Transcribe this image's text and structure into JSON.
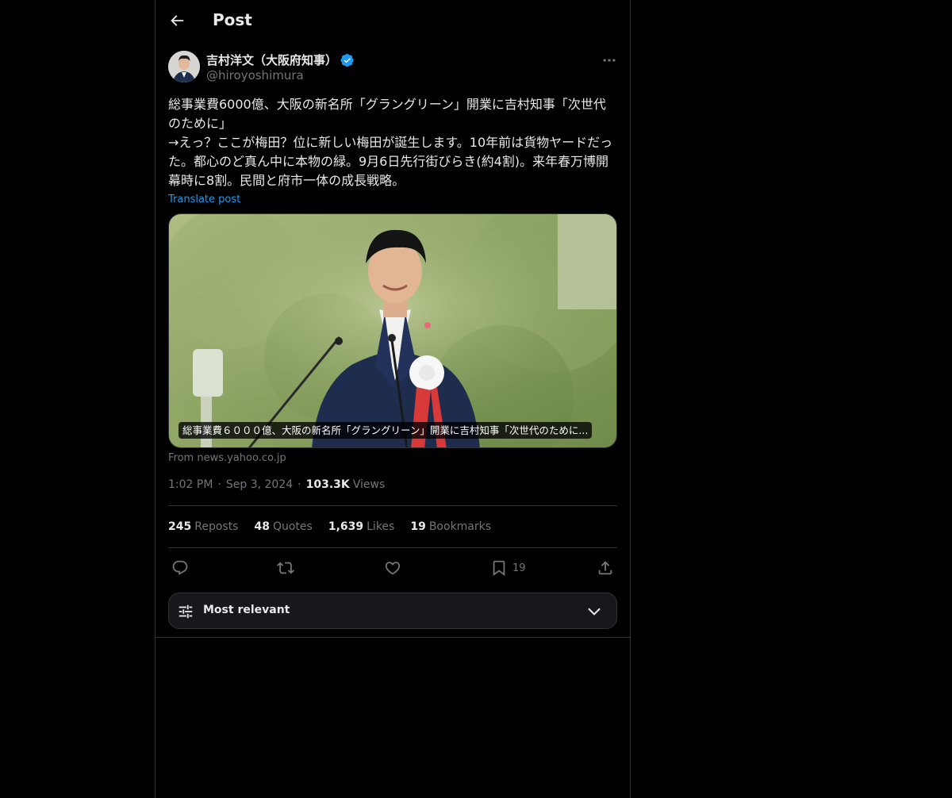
{
  "header": {
    "title": "Post"
  },
  "post": {
    "author_name": "吉村洋文（大阪府知事）",
    "author_handle": "@hiroyoshimura",
    "text": "総事業費6000億、大阪の新名所「グラングリーン」開業に吉村知事「次世代のために」\n→えっ？ここが梅田？位に新しい梅田が誕生します。10年前は貨物ヤードだった。都心のど真ん中に本物の緑。9月6日先行街びらき(約4割)。来年春万博開幕時に8割。民間と府市一体の成長戦略。",
    "translate_label": "Translate post",
    "media_caption": "総事業費６０００億、大阪の新名所「グラングリーン」開業に吉村知事「次世代のために...",
    "source": "From news.yahoo.co.jp",
    "time": "1:02 PM",
    "date": "Sep 3, 2024",
    "views_count": "103.3K",
    "views_label": "Views"
  },
  "stats": {
    "reposts_count": "245",
    "reposts_label": "Reposts",
    "quotes_count": "48",
    "quotes_label": "Quotes",
    "likes_count": "1,639",
    "likes_label": "Likes",
    "bookmarks_count": "19",
    "bookmarks_label": "Bookmarks"
  },
  "actions": {
    "reply_icon": "reply-icon",
    "repost_icon": "repost-icon",
    "like_icon": "heart-icon",
    "bookmark_icon": "bookmark-icon",
    "bookmark_count": "19",
    "share_icon": "share-icon"
  },
  "sort": {
    "label": "Most relevant"
  },
  "colors": {
    "background": "#000000",
    "border": "#2f3336",
    "text_primary": "#e7e9ea",
    "text_secondary": "#71767b",
    "accent": "#1d9bf0"
  }
}
